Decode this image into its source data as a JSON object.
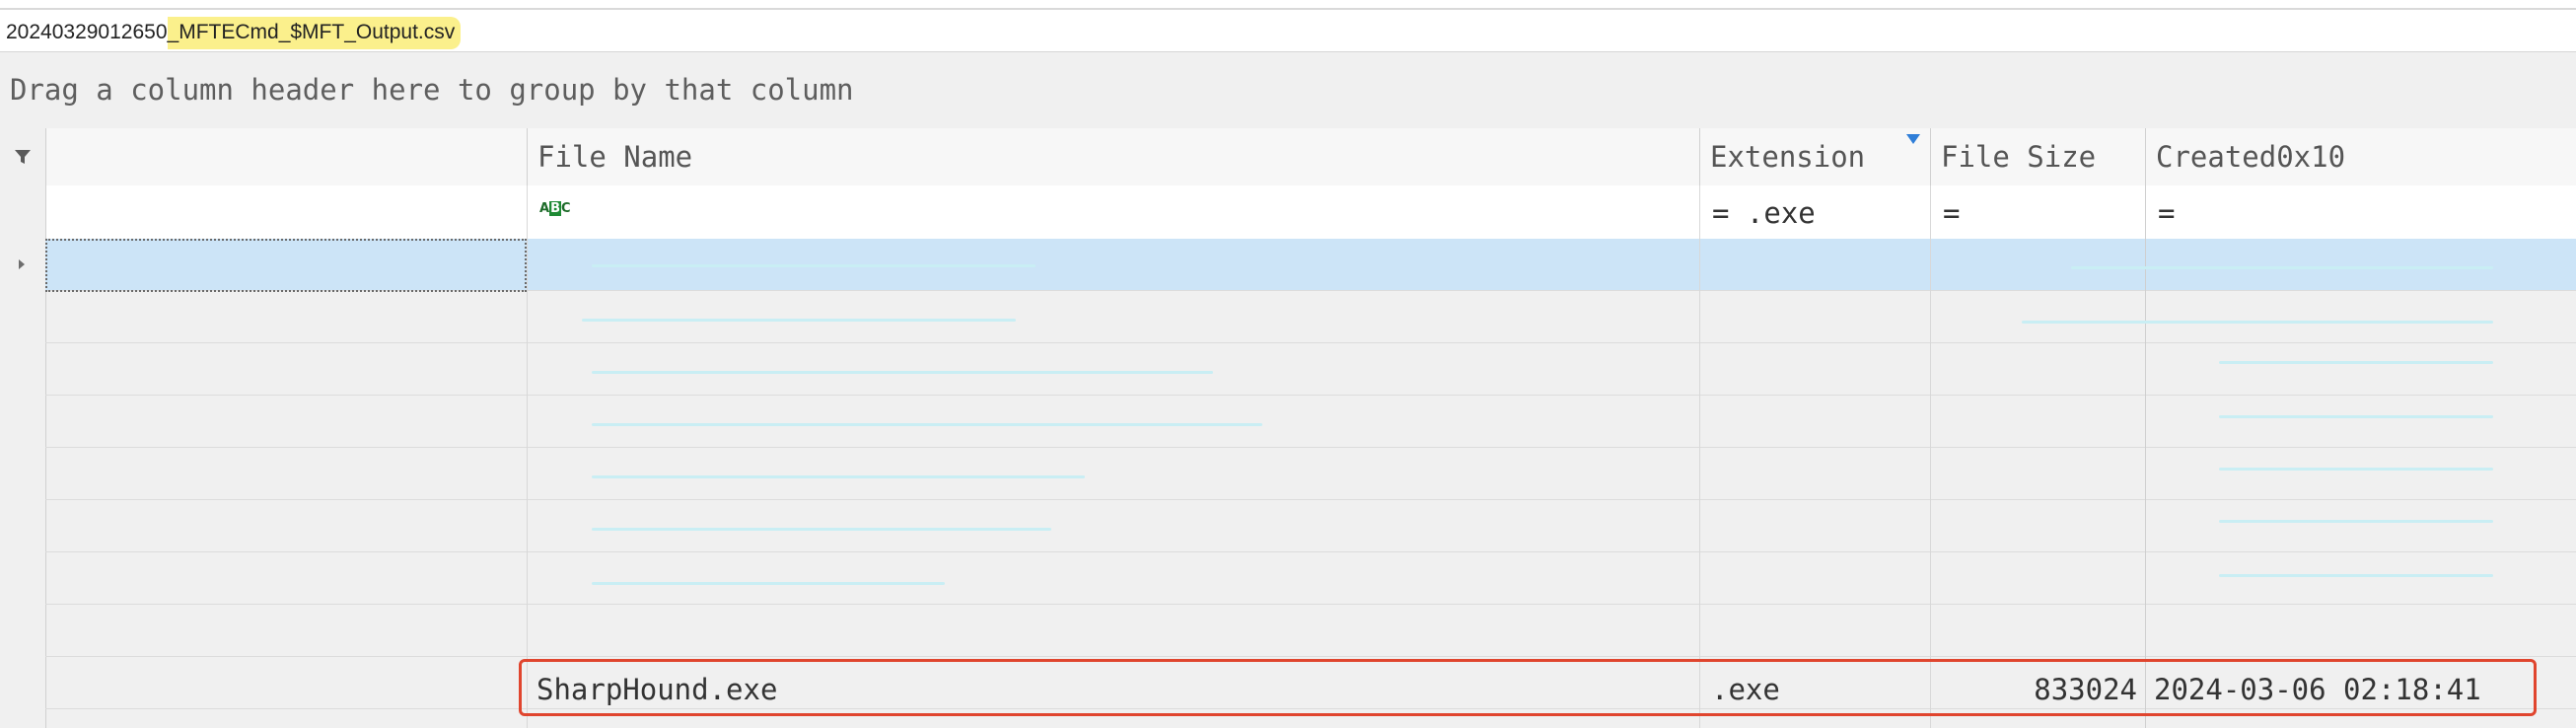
{
  "tab": {
    "prefix": "20240329012650",
    "title": "_MFTECmd_$MFT_Output.csv"
  },
  "group_panel": {
    "text": "Drag a column header here to group by that column"
  },
  "columns": [
    {
      "label": ""
    },
    {
      "label": "File Name"
    },
    {
      "label": "Extension"
    },
    {
      "label": "File Size"
    },
    {
      "label": "Created0x10"
    }
  ],
  "filters": {
    "file_name": "",
    "extension": "= .exe",
    "file_size": "=",
    "created": "="
  },
  "highlighted_row": {
    "file_name": "SharpHound.exe",
    "extension": ".exe",
    "file_size": "833024",
    "created": "2024-03-06 02:18:41"
  },
  "colors": {
    "selection": "#cce4f7",
    "highlight_box": "#e0452e",
    "tab_highlight": "#fbf08c"
  }
}
